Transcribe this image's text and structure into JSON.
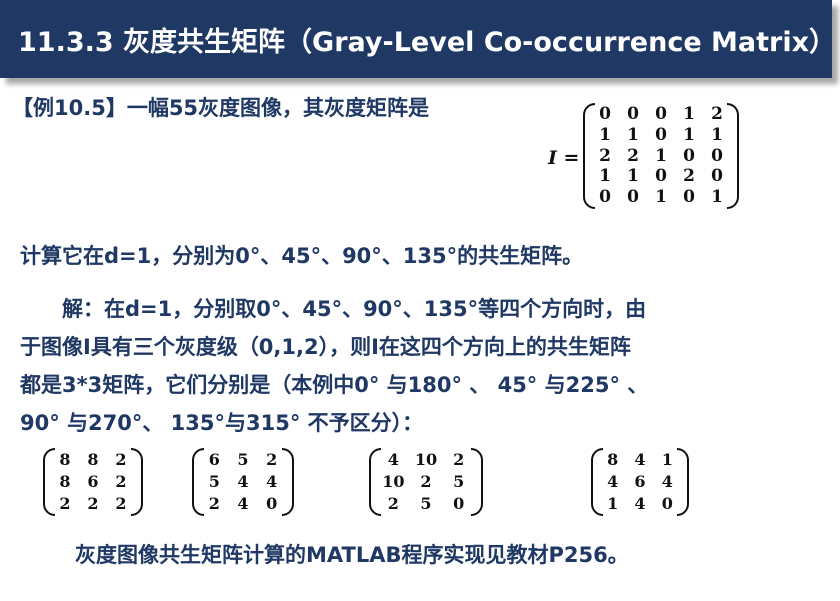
{
  "header": {
    "title": "11.3.3 灰度共生矩阵（Gray-Level Co-occurrence Matrix）"
  },
  "example_text": "【例10.5】一幅55灰度图像，其灰度矩阵是",
  "matrix_label": "I =",
  "image_matrix": [
    [
      "0",
      "0",
      "0",
      "1",
      "2"
    ],
    [
      "1",
      "1",
      "0",
      "1",
      "1"
    ],
    [
      "2",
      "2",
      "1",
      "0",
      "0"
    ],
    [
      "1",
      "1",
      "0",
      "2",
      "0"
    ],
    [
      "0",
      "0",
      "1",
      "0",
      "1"
    ]
  ],
  "question_text": "计算它在d=1，分别为0°、45°、90°、135°的共生矩阵。",
  "solution_lines": [
    "　　解：在d=1，分别取0°、45°、90°、135°等四个方向时，由",
    "于图像I具有三个灰度级（0,1,2），则I在这四个方向上的共生矩阵",
    "都是3*3矩阵，它们分别是（本例中0° 与180° 、 45° 与225° 、",
    "90° 与270°、 135°与315° 不予区分）："
  ],
  "cooccurrence_matrices": [
    [
      [
        "8",
        "8",
        "2"
      ],
      [
        "8",
        "6",
        "2"
      ],
      [
        "2",
        "2",
        "2"
      ]
    ],
    [
      [
        "6",
        "5",
        "2"
      ],
      [
        "5",
        "4",
        "4"
      ],
      [
        "2",
        "4",
        "0"
      ]
    ],
    [
      [
        "4",
        "10",
        "2"
      ],
      [
        "10",
        "2",
        "5"
      ],
      [
        "2",
        "5",
        "0"
      ]
    ],
    [
      [
        "8",
        "4",
        "1"
      ],
      [
        "4",
        "6",
        "4"
      ],
      [
        "1",
        "4",
        "0"
      ]
    ]
  ],
  "footer_text": "灰度图像共生矩阵计算的MATLAB程序实现见教材P256。"
}
